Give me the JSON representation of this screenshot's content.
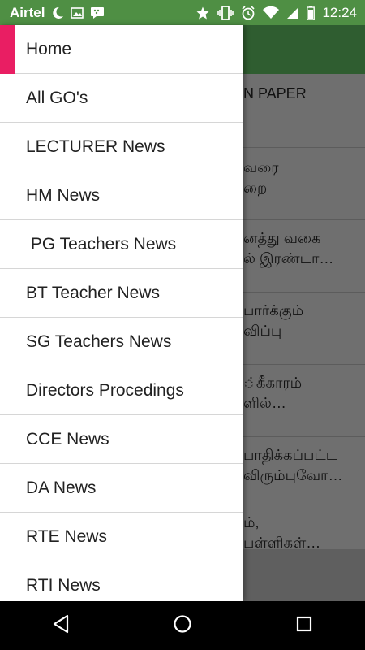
{
  "status_bar": {
    "carrier": "Airtel",
    "time": "12:24",
    "icons_left": [
      "moon-icon",
      "image-icon",
      "bbm-chat-icon"
    ],
    "icons_right": [
      "star-icon",
      "vibrate-icon",
      "alarm-icon",
      "wifi-icon",
      "signal-icon",
      "battery-icon"
    ]
  },
  "background_list": {
    "rows": [
      {
        "line1": "N PAPER",
        "line2": ""
      },
      {
        "line1": "வரை",
        "line2": "றை"
      },
      {
        "line1": "னத்து வகை",
        "line2": "ல் இரண்டா…"
      },
      {
        "line1": "பார்க்கும்",
        "line2": "விப்பு"
      },
      {
        "line1": "்கீகாரம்",
        "line2": "ளில்…"
      },
      {
        "line1": "பாதிக்கப்பட்ட",
        "line2": "விரும்புவோ…"
      },
      {
        "line1": "ம்,",
        "line2": "பள்ளிகள்…"
      }
    ]
  },
  "drawer": {
    "items": [
      {
        "label": "Home"
      },
      {
        "label": "All GO's"
      },
      {
        "label": "LECTURER News"
      },
      {
        "label": "HM News"
      },
      {
        "label": " PG Teachers News"
      },
      {
        "label": "BT Teacher News"
      },
      {
        "label": "SG Teachers News"
      },
      {
        "label": "Directors Procedings"
      },
      {
        "label": "CCE News"
      },
      {
        "label": "DA News"
      },
      {
        "label": "RTE News"
      },
      {
        "label": "RTI News"
      }
    ],
    "active_index": 0
  },
  "navigation": {
    "buttons": [
      "back-icon",
      "home-icon",
      "recents-icon"
    ]
  },
  "colors": {
    "status_bar": "#4f8f44",
    "app_header": "#2f5d30",
    "active_indicator": "#e91e63",
    "drawer_bg": "#ffffff",
    "nav_bar": "#000000"
  }
}
